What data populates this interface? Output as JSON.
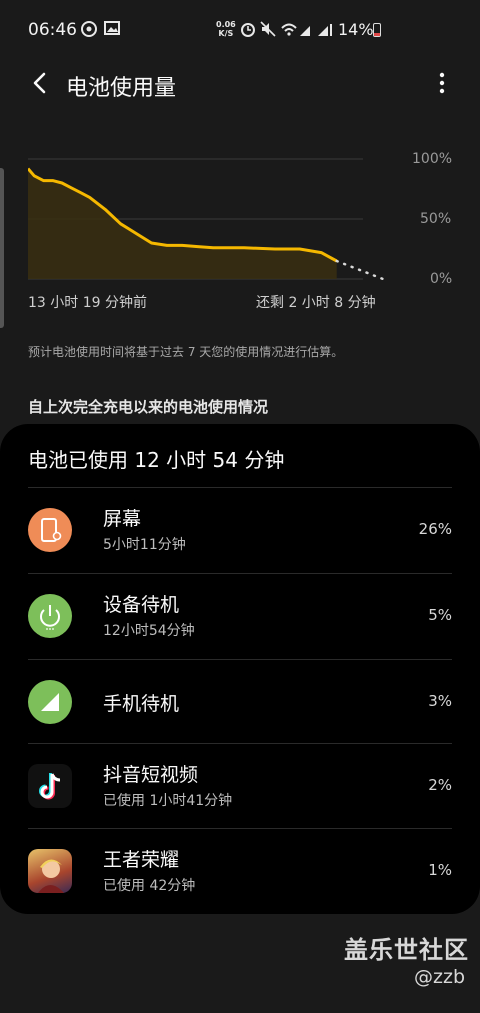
{
  "status_bar": {
    "time": "06:46",
    "net_speed_value": "0.06",
    "net_speed_unit": "K/S",
    "battery_percent": "14%"
  },
  "header": {
    "title": "电池使用量"
  },
  "chart_data": {
    "type": "area",
    "yticks": [
      "100%",
      "50%",
      "0%"
    ],
    "ylim": [
      0,
      100
    ],
    "x_start_label": "13 小时 19 分钟前",
    "x_end_label": "还剩 2 小时 8 分钟",
    "x": [
      0,
      2,
      5,
      8,
      11,
      14,
      17,
      20,
      25,
      30,
      35,
      40,
      45,
      50,
      55,
      60,
      70,
      80,
      88,
      95,
      100
    ],
    "values": [
      92,
      86,
      82,
      82,
      80,
      76,
      72,
      68,
      58,
      46,
      38,
      30,
      28,
      28,
      27,
      26,
      26,
      25,
      25,
      22,
      15
    ],
    "projection_x": [
      100,
      115
    ],
    "projection_values": [
      15,
      0
    ],
    "line_color": "#f5b800",
    "grid": true
  },
  "prediction_note": "预计电池使用时间将基于过去 7 天您的使用情况进行估算。",
  "section_title": "自上次完全充电以来的电池使用情况",
  "usage_card": {
    "total_used": "电池已使用 12 小时 54 分钟",
    "items": [
      {
        "name": "屏幕",
        "detail": "5小时11分钟",
        "percent": "26%",
        "icon": "screen-icon",
        "color": "#ef8c57"
      },
      {
        "name": "设备待机",
        "detail": "12小时54分钟",
        "percent": "5%",
        "icon": "power-icon",
        "color": "#7dbf5a"
      },
      {
        "name": "手机待机",
        "detail": "",
        "percent": "3%",
        "icon": "signal-icon",
        "color": "#7dbf5a"
      },
      {
        "name": "抖音短视频",
        "detail": "已使用 1小时41分钟",
        "percent": "2%",
        "icon": "tiktok-app-icon",
        "color": "#111111"
      },
      {
        "name": "王者荣耀",
        "detail": "已使用 42分钟",
        "percent": "1%",
        "icon": "game-app-icon",
        "color": "#d4a137"
      }
    ]
  },
  "watermark": {
    "line1": "盖乐世社区",
    "line2": "@zzb"
  }
}
